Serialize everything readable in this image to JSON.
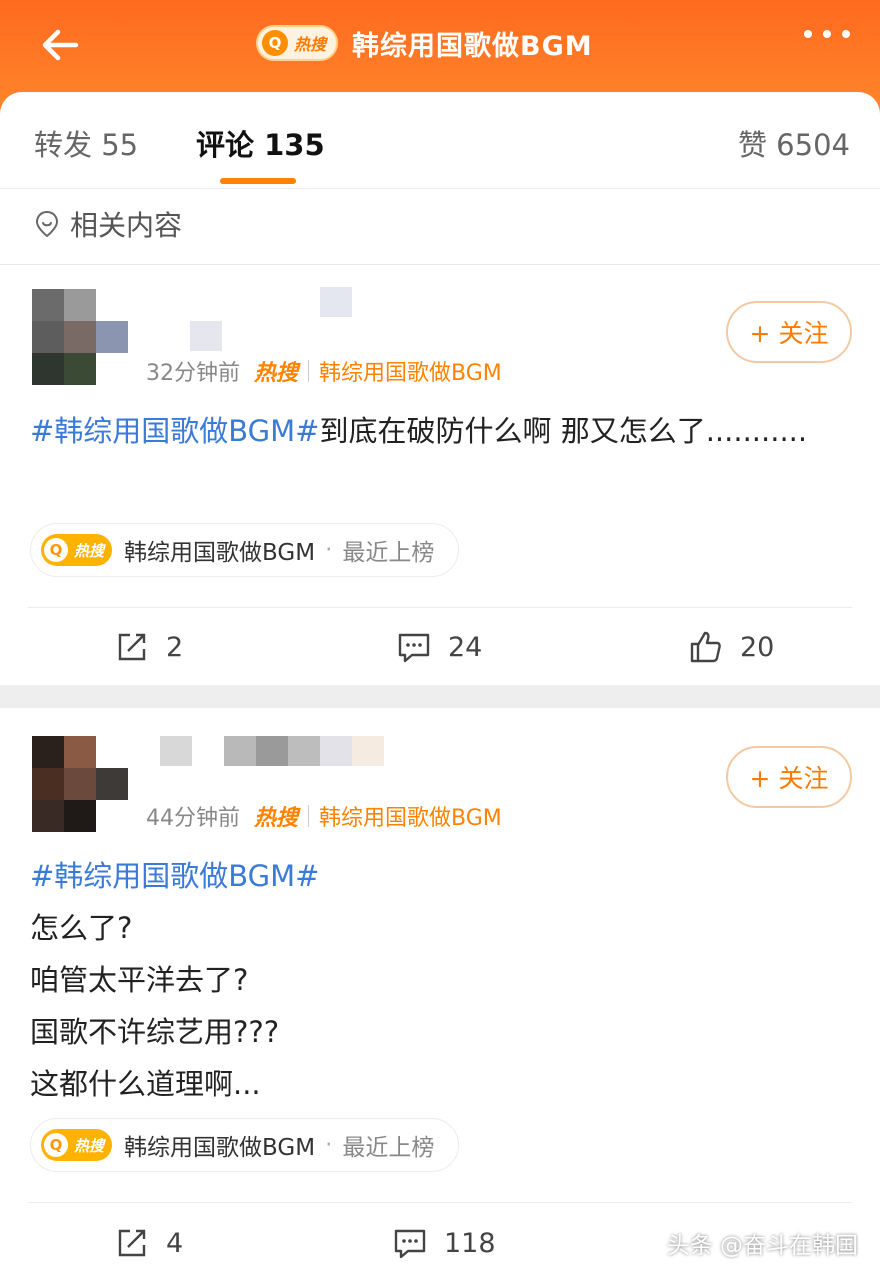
{
  "header": {
    "hot_logo_letter": "Q",
    "hot_logo_text": "热搜",
    "topic_title": "韩综用国歌做BGM",
    "background": "#ff7a22"
  },
  "tabs": {
    "reposts": "转发 55",
    "comments": "评论 135",
    "likes": "赞 6504",
    "accent": "#ff8200"
  },
  "related": "相关内容",
  "posts": [
    {
      "time": "32分钟前",
      "hot_label": "热搜",
      "topic": "韩综用国歌做BGM",
      "follow": "+ 关注",
      "hashtag": "#韩综用国歌做BGM#",
      "text": "到底在破防什么啊 那又怎么了...........",
      "chip_topic": "韩综用国歌做BGM",
      "chip_dot": "·",
      "chip_status": "最近上榜",
      "reposts": "2",
      "comments": "24",
      "likes": "20"
    },
    {
      "time": "44分钟前",
      "hot_label": "热搜",
      "topic": "韩综用国歌做BGM",
      "follow": "+ 关注",
      "hashtag": "#韩综用国歌做BGM#",
      "lines": [
        "怎么了?",
        "咱管太平洋去了?",
        "国歌不许综艺用???",
        "这都什么道理啊..."
      ],
      "chip_topic": "韩综用国歌做BGM",
      "chip_dot": "·",
      "chip_status": "最近上榜",
      "reposts": "4",
      "comments": "118"
    }
  ],
  "watermark": "头条 @奋斗在韩国"
}
